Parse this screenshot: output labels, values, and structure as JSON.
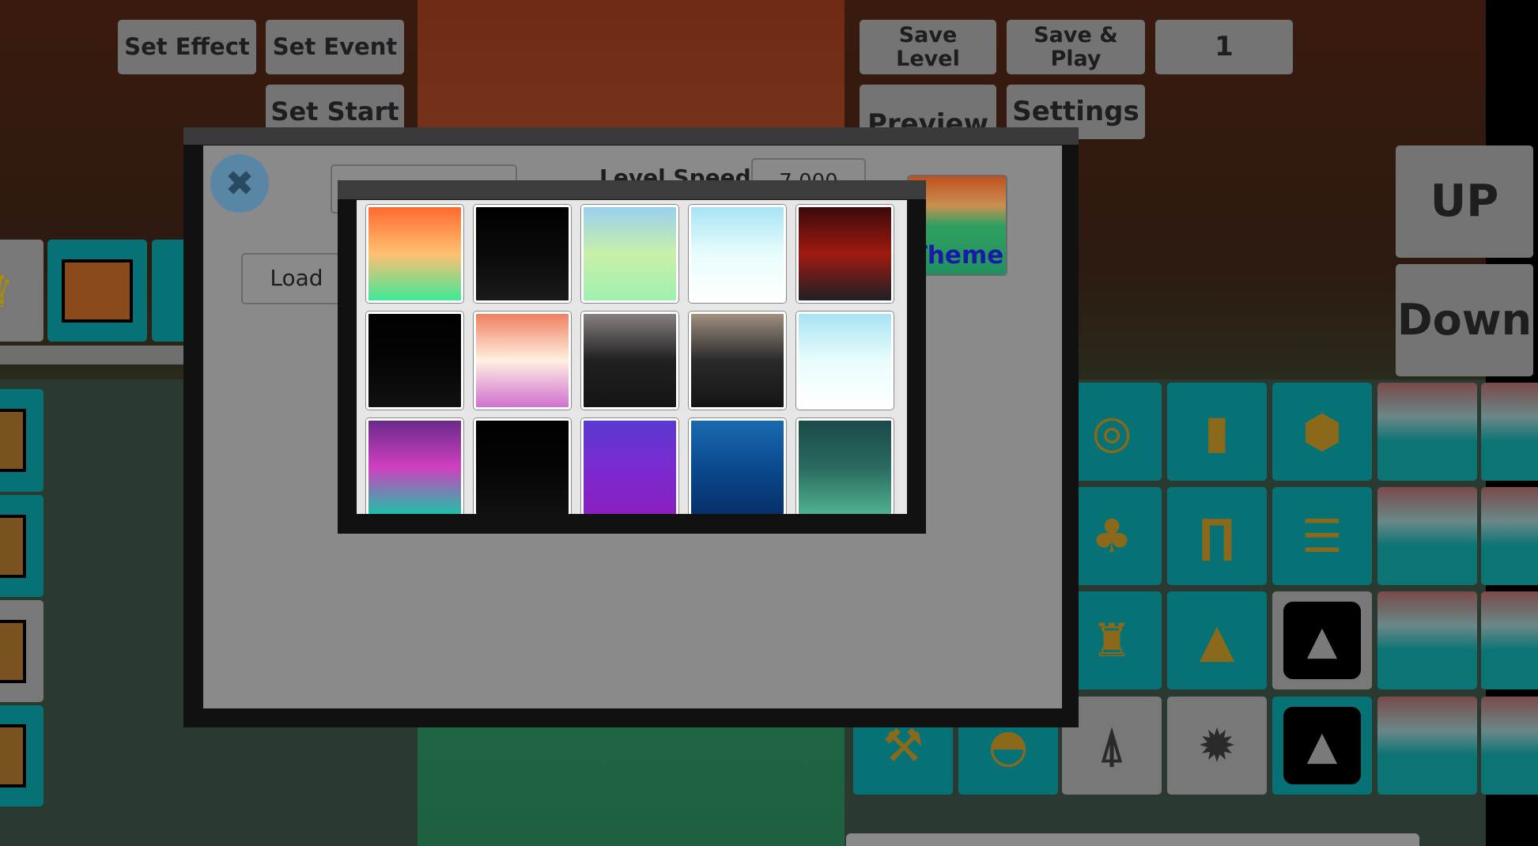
{
  "toolbar_left": {
    "set_effect": "Set Effect",
    "set_event": "Set Event",
    "set_start": "Set Start"
  },
  "toolbar_right": {
    "save_level": "Save Level",
    "save_play": "Save & Play",
    "level_number": "1",
    "preview": "Preview",
    "settings": "Settings"
  },
  "side_controls": {
    "up": "UP",
    "down": "Down"
  },
  "modal": {
    "close_icon": "close-icon",
    "close_color": "#5a86a6",
    "name_input_value": "",
    "level_speed_label": "Level Speed:",
    "level_speed_value": "7.000",
    "load_label": "Load",
    "theme_label": "Theme",
    "theme_label_color": "#1a1aa8"
  },
  "theme_picker": {
    "tiles": [
      {
        "colors": [
          "#ff6a30",
          "#ffc070",
          "#40e898"
        ]
      },
      {
        "colors": [
          "#000000",
          "#0a0a0a",
          "#1a1a1a"
        ]
      },
      {
        "colors": [
          "#9ad0f0",
          "#c8f0a8",
          "#a0f0b0"
        ]
      },
      {
        "colors": [
          "#a8e4f4",
          "#e8fcfc",
          "#ffffff"
        ]
      },
      {
        "colors": [
          "#3a0a0a",
          "#a01a10",
          "#1e2024"
        ]
      },
      {
        "colors": [
          "#000000",
          "#050505",
          "#111111"
        ]
      },
      {
        "colors": [
          "#f08060",
          "#fff0e0",
          "#d070d0"
        ]
      },
      {
        "colors": [
          "#888080",
          "#202020",
          "#151515"
        ]
      },
      {
        "colors": [
          "#a09080",
          "#2a2a2a",
          "#151515"
        ]
      },
      {
        "colors": [
          "#a8e4f4",
          "#e8fcfc",
          "#ffffff"
        ]
      },
      {
        "colors": [
          "#6a2a8a",
          "#d040c0",
          "#20c0a8"
        ]
      },
      {
        "colors": [
          "#000000",
          "#050505",
          "#111111"
        ]
      },
      {
        "colors": [
          "#5a3ad0",
          "#7a2ad0",
          "#8a20c0"
        ]
      },
      {
        "colors": [
          "#1a6ab0",
          "#0a4a90",
          "#08306a"
        ]
      },
      {
        "colors": [
          "#1a4a48",
          "#2a6a60",
          "#50b090"
        ]
      }
    ]
  },
  "left_palette": {
    "top_row": [
      "crown-icon",
      "triangle-block-icon",
      "block-icon"
    ],
    "column": [
      "slope-block-icon",
      "half-block-icon",
      "arrow-block-icon",
      "arrow-block-icon"
    ]
  },
  "right_palette": {
    "cells": [
      {
        "row": 0,
        "col": 2,
        "bg": "teal",
        "icon": "cannon-icon",
        "glyph": "◎"
      },
      {
        "row": 0,
        "col": 3,
        "bg": "teal",
        "icon": "pillar-icon",
        "glyph": "▮"
      },
      {
        "row": 0,
        "col": 4,
        "bg": "teal",
        "icon": "cube-icon",
        "glyph": "⬢"
      },
      {
        "row": 0,
        "col": 5,
        "bg": "pic",
        "icon": "machine-icon",
        "glyph": ""
      },
      {
        "row": 0,
        "col": 6,
        "bg": "pic",
        "icon": "machine-icon",
        "glyph": ""
      },
      {
        "row": 1,
        "col": 2,
        "bg": "teal",
        "icon": "tree-icon",
        "glyph": "♣"
      },
      {
        "row": 1,
        "col": 3,
        "bg": "teal",
        "icon": "arch-icon",
        "glyph": "∏"
      },
      {
        "row": 1,
        "col": 4,
        "bg": "teal",
        "icon": "stack-icon",
        "glyph": "☰"
      },
      {
        "row": 1,
        "col": 5,
        "bg": "pic",
        "icon": "block-3d-icon",
        "glyph": ""
      },
      {
        "row": 1,
        "col": 6,
        "bg": "pic",
        "icon": "machine-icon",
        "glyph": ""
      },
      {
        "row": 2,
        "col": 2,
        "bg": "teal",
        "icon": "tower-icon",
        "glyph": "♜"
      },
      {
        "row": 2,
        "col": 3,
        "bg": "teal",
        "icon": "pyramid-icon",
        "glyph": "▲"
      },
      {
        "row": 2,
        "col": 4,
        "bg": "gray",
        "icon": "spike-icon",
        "glyph": "▲"
      },
      {
        "row": 2,
        "col": 5,
        "bg": "pic",
        "icon": "block-3d-icon",
        "glyph": ""
      },
      {
        "row": 2,
        "col": 6,
        "bg": "pic",
        "icon": "machine-icon",
        "glyph": ""
      },
      {
        "row": 3,
        "col": 0,
        "bg": "teal",
        "icon": "hammer-icon",
        "glyph": "⚒"
      },
      {
        "row": 3,
        "col": 1,
        "bg": "teal",
        "icon": "dome-icon",
        "glyph": "◓"
      },
      {
        "row": 3,
        "col": 2,
        "bg": "gray",
        "icon": "lattice-tower-icon",
        "glyph": "⍋"
      },
      {
        "row": 3,
        "col": 3,
        "bg": "gray",
        "icon": "saw-icon",
        "glyph": "✹"
      },
      {
        "row": 3,
        "col": 4,
        "bg": "teal",
        "icon": "spike-icon",
        "glyph": "▲"
      },
      {
        "row": 3,
        "col": 5,
        "bg": "pic",
        "icon": "orb-icon",
        "glyph": ""
      },
      {
        "row": 3,
        "col": 6,
        "bg": "pic",
        "icon": "machine-icon",
        "glyph": ""
      }
    ]
  }
}
